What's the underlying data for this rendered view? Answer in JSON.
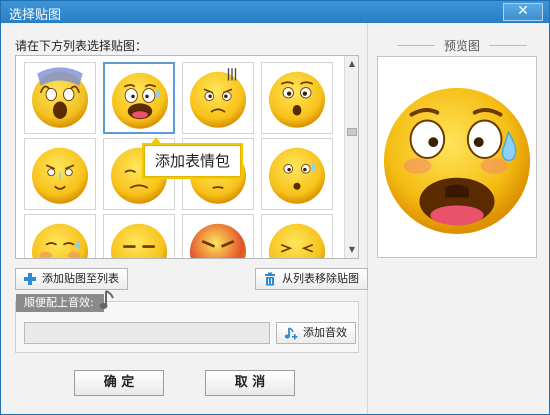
{
  "window": {
    "title": "选择贴图",
    "close_glyph": "✕"
  },
  "list": {
    "instruction": "请在下方列表选择贴图：",
    "stickers": [
      {
        "id": "screaming"
      },
      {
        "id": "frightened",
        "selected": true
      },
      {
        "id": "sweating"
      },
      {
        "id": "surprised"
      },
      {
        "id": "crying"
      },
      {
        "id": "sleepy"
      },
      {
        "id": "dazed"
      },
      {
        "id": "nervous"
      },
      {
        "id": "blushing"
      },
      {
        "id": "annoyed"
      },
      {
        "id": "angry"
      },
      {
        "id": "grinning"
      }
    ],
    "tooltip": "添加表情包"
  },
  "actions": {
    "add_label": "添加贴图至列表",
    "remove_label": "从列表移除贴图"
  },
  "sound": {
    "tag": "顺便配上音效:",
    "add_label": "添加音效",
    "input_value": ""
  },
  "footer": {
    "ok": "确 定",
    "cancel": "取 消"
  },
  "preview": {
    "label": "预览图"
  },
  "colors": {
    "title_bar": "#2f86cc",
    "accent_blue": "#5b9bd5",
    "tooltip_border": "#f3c800",
    "emoji_yellow": "#f7c21b"
  }
}
